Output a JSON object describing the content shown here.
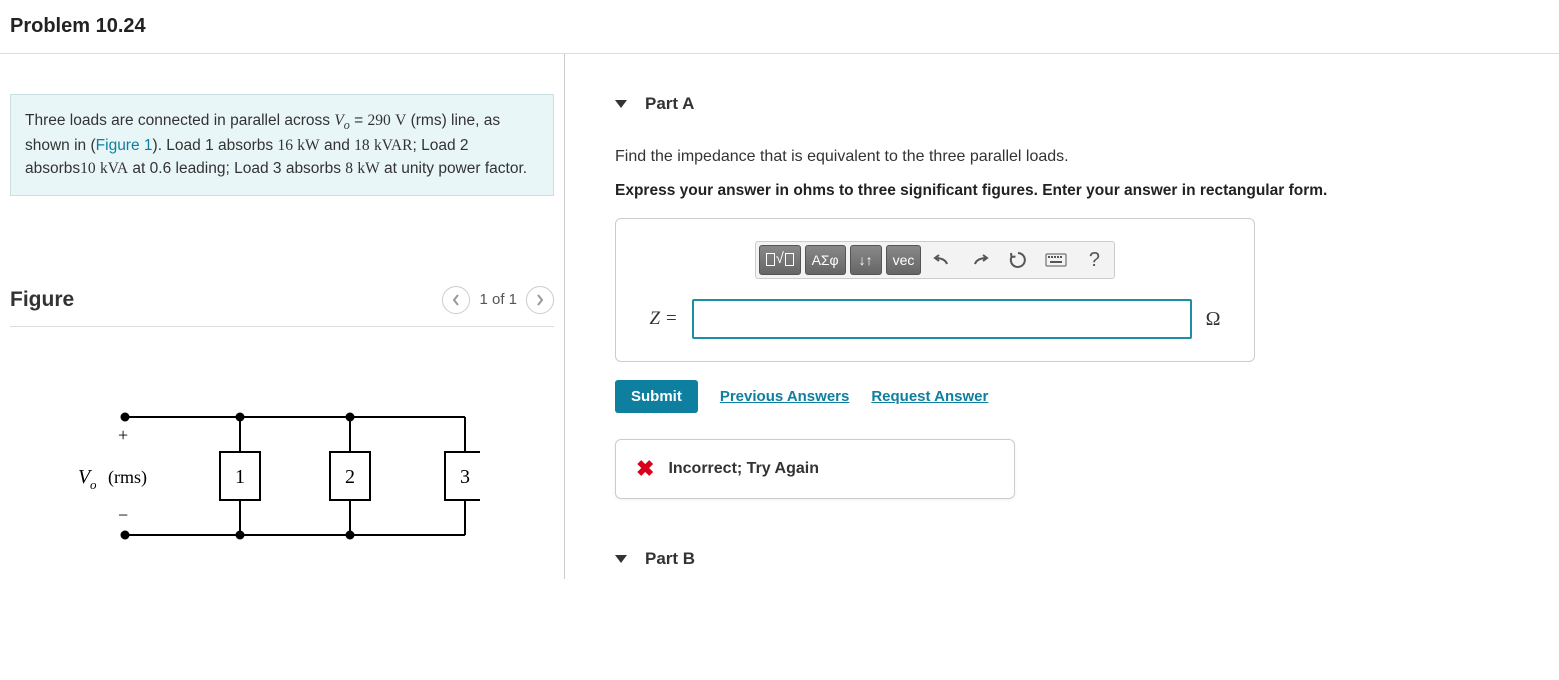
{
  "header": {
    "title": "Problem 10.24"
  },
  "problem": {
    "vo_symbol": "V",
    "vo_sub": "o",
    "vo_value": "290",
    "vo_unit": "V",
    "vo_note": "(rms)",
    "figure_ref": "Figure 1",
    "p1": "Three loads are connected in parallel across ",
    "p2": " = ",
    "p3": " line, as shown in (",
    "p4": "). Load 1 absorbs ",
    "l1_p": "16",
    "l1_pu": "kW",
    "p5": " and ",
    "l1_q": "18",
    "l1_qu": "kVAR",
    "p6": "; Load 2 absorbs",
    "l2_s": "10",
    "l2_su": "kVA",
    "p7": " at 0.6 leading; Load 3 absorbs ",
    "l3_p": "8",
    "l3_pu": "kW",
    "p8": " at unity power factor."
  },
  "figure": {
    "title": "Figure",
    "counter": "1 of 1",
    "source_label": "V",
    "source_sub": "o",
    "source_note": "(rms)",
    "plus": "+",
    "minus": "−",
    "loads": [
      "1",
      "2",
      "3"
    ]
  },
  "partA": {
    "label": "Part A",
    "instruction": "Find the impedance that is equivalent to the three parallel loads.",
    "bold": "Express your answer in ohms to three significant figures. Enter your answer in rectangular form.",
    "toolbar": {
      "templates": "▯√▯",
      "greek": "ΑΣφ",
      "subsup": "↓↑",
      "vec": "vec",
      "help": "?"
    },
    "answer_label": "Z =",
    "answer_value": "",
    "unit": "Ω",
    "submit": "Submit",
    "prev": "Previous Answers",
    "req": "Request Answer",
    "feedback": "Incorrect; Try Again"
  },
  "partB": {
    "label": "Part B"
  }
}
